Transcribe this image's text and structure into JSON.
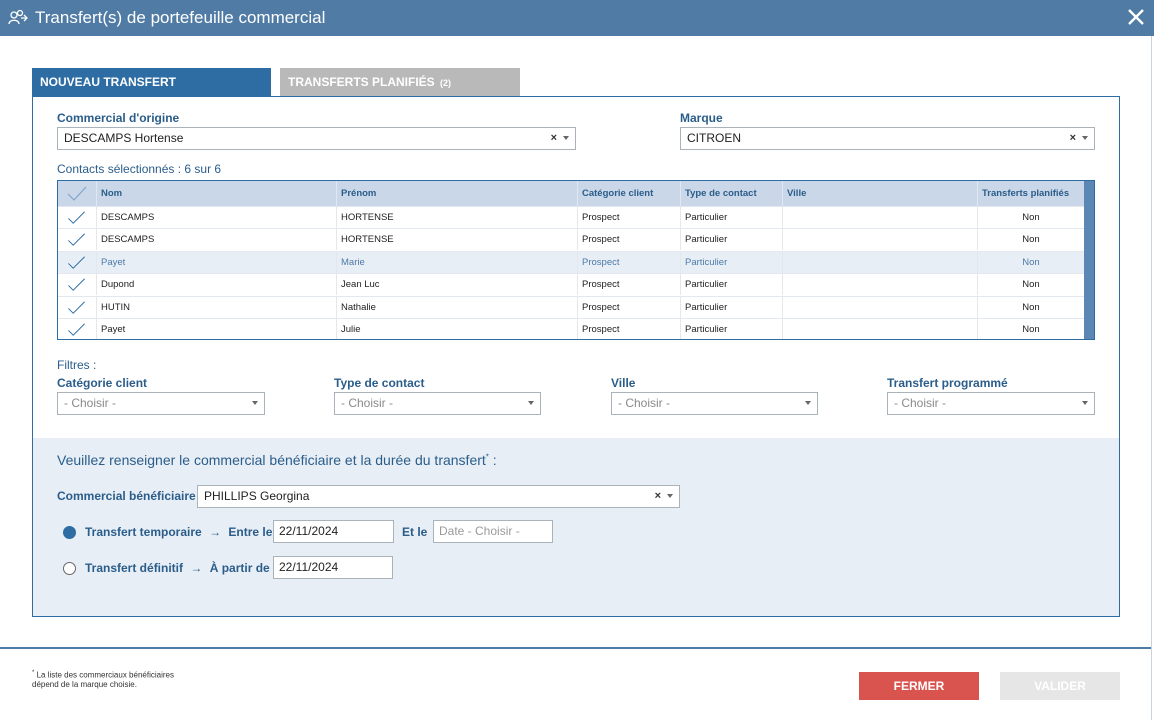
{
  "window": {
    "title": "Transfert(s) de portefeuille commercial"
  },
  "tabs": {
    "new": "NOUVEAU TRANSFERT",
    "planned": "TRANSFERTS PLANIFIÉS",
    "planned_count": "(2)"
  },
  "origin": {
    "label": "Commercial d'origine",
    "value": "DESCAMPS Hortense",
    "clear": "×"
  },
  "brand": {
    "label": "Marque",
    "value": "CITROEN",
    "clear": "×"
  },
  "selection": {
    "summary": "Contacts sélectionnés : 6 sur 6"
  },
  "table": {
    "headers": [
      "Nom",
      "Prénom",
      "Catégorie client",
      "Type de contact",
      "Ville",
      "Transferts planifiés"
    ],
    "rows": [
      [
        "DESCAMPS",
        "HORTENSE",
        "Prospect",
        "Particulier",
        "",
        "Non"
      ],
      [
        "DESCAMPS",
        "HORTENSE",
        "Prospect",
        "Particulier",
        "",
        "Non"
      ],
      [
        "Payet",
        "Marie",
        "Prospect",
        "Particulier",
        "",
        "Non"
      ],
      [
        "Dupond",
        "Jean Luc",
        "Prospect",
        "Particulier",
        "",
        "Non"
      ],
      [
        "HUTIN",
        "Nathalie",
        "Prospect",
        "Particulier",
        "",
        "Non"
      ],
      [
        "Payet",
        "Julie",
        "Prospect",
        "Particulier",
        "",
        "Non"
      ]
    ]
  },
  "filters": {
    "title": "Filtres :",
    "category": {
      "label": "Catégorie client",
      "value": "- Choisir -"
    },
    "contact_type": {
      "label": "Type de contact",
      "value": "- Choisir -"
    },
    "city": {
      "label": "Ville",
      "value": "- Choisir -"
    },
    "scheduled": {
      "label": "Transfert programmé",
      "value": "- Choisir -"
    }
  },
  "transfer": {
    "prompt": "Veuillez renseigner le commercial bénéficiaire et la durée du transfert",
    "prompt_mark": "*",
    "prompt_colon": " :",
    "beneficiary": {
      "label": "Commercial bénéficiaire",
      "value": "PHILLIPS Georgina",
      "clear": "×"
    },
    "temporary": {
      "label": "Transfert temporaire",
      "arrow": "→",
      "between": "Entre le",
      "start": "22/11/2024",
      "and": "Et le",
      "end_placeholder": "Date - Choisir -"
    },
    "permanent": {
      "label": "Transfert définitif",
      "arrow": "→",
      "from": "À partir de",
      "start": "22/11/2024"
    }
  },
  "footer": {
    "note_mark": "*",
    "note_line1": " La liste des commerciaux bénéficiaires",
    "note_line2": "dépend de la marque choisie.",
    "close": "FERMER",
    "validate": "VALIDER"
  },
  "colors": {
    "header": "#4f7ba5",
    "accent": "#2e6da4",
    "danger": "#d9534f",
    "disabled": "#e6e6e6"
  },
  "icons": {
    "app": "users-transfer-icon",
    "close": "close-icon",
    "check": "check-icon"
  }
}
